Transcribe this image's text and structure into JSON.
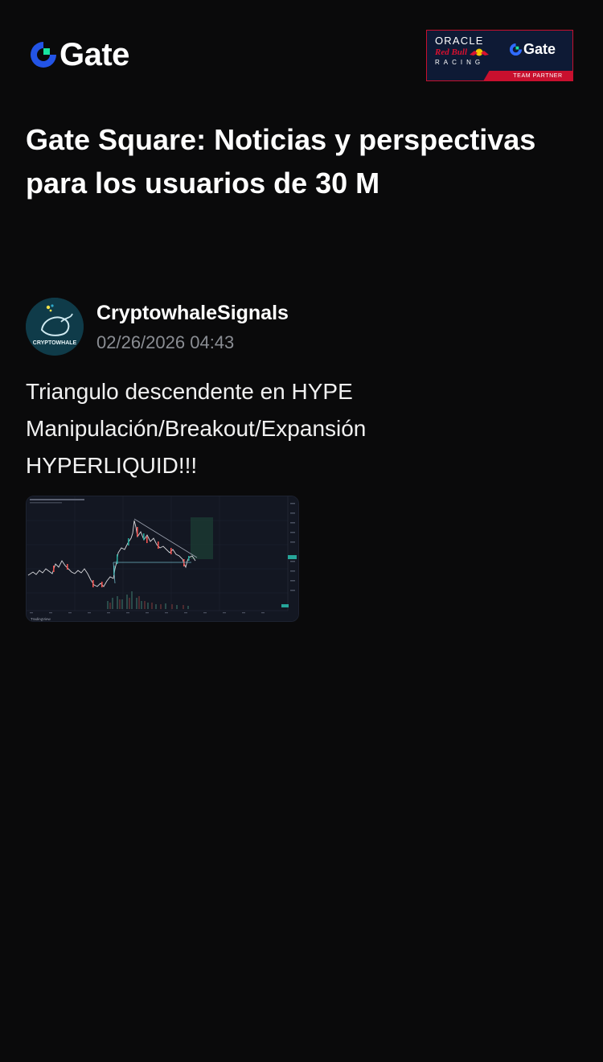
{
  "header": {
    "brand": "Gate",
    "partner_banner": {
      "oracle": "ORACLE",
      "redbull": "Red Bull",
      "racing": "RACING",
      "gate": "Gate",
      "strip": "TEAM PARTNER"
    }
  },
  "page_title": "Gate Square: Noticias y perspectivas para los usuarios de 30 M",
  "post": {
    "author": "CryptowhaleSignals",
    "avatar_label": "CRYPTOWHALE",
    "timestamp": "02/26/2026 04:43",
    "body_lines": [
      "Triangulo descendente en HYPE",
      "Manipulación/Breakout/Expansión",
      "HYPERLIQUID!!!"
    ],
    "image_alt_brand": "TradingView"
  },
  "colors": {
    "background": "#0a0a0b",
    "brand_blue": "#2354e6",
    "brand_green": "#17e5a1",
    "partner_red": "#c8102e",
    "partner_navy": "#0e1a35",
    "muted_text": "#8a8d93"
  }
}
